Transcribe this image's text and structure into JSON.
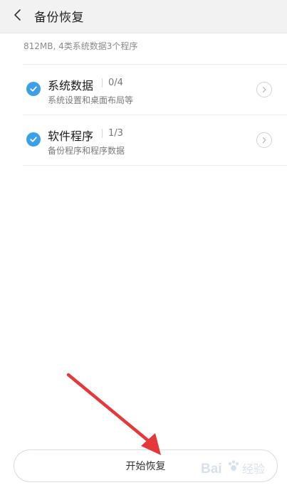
{
  "header": {
    "back_icon": "chevron-left-icon",
    "title": "备份恢复"
  },
  "summary": "812MB, 4类系统数据3个程序",
  "items": [
    {
      "title": "系统数据",
      "count": "0/4",
      "subtitle": "系统设置和桌面布局等",
      "checked": true,
      "icon": "check-icon",
      "arrow_icon": "chevron-right-icon"
    },
    {
      "title": "软件程序",
      "count": "1/3",
      "subtitle": "备份程序和程序数据",
      "checked": true,
      "icon": "check-icon",
      "arrow_icon": "chevron-right-icon"
    }
  ],
  "start_button": {
    "label": "开始恢复"
  },
  "annotation": {
    "icon": "red-arrow-icon",
    "color": "#e5383b"
  },
  "watermark": {
    "icon": "baidu-jingyan-watermark",
    "text": "Bai经验"
  },
  "colors": {
    "accent": "#3aa0ec",
    "header_bg": "#f2f2f2",
    "arrow_red": "#e5383b"
  }
}
